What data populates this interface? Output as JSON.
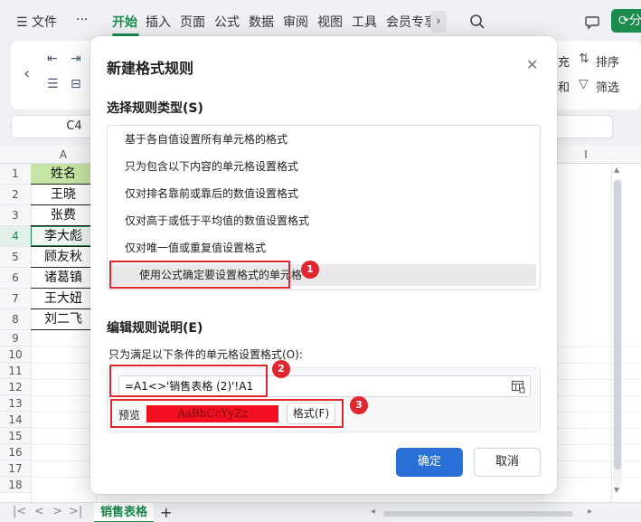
{
  "menubar": {
    "file": "文件",
    "more": "···",
    "tabs": [
      "开始",
      "插入",
      "页面",
      "公式",
      "数据",
      "审阅",
      "视图",
      "工具",
      "会员专享"
    ],
    "share": "分"
  },
  "ribbon": {
    "fill": "充",
    "sort": "排序",
    "sum": "和",
    "filter": "筛选"
  },
  "namebox": "C4",
  "sheet": {
    "columns": [
      "A",
      "I"
    ],
    "rows": [
      "1",
      "2",
      "3",
      "4",
      "5",
      "6",
      "7",
      "8",
      "9",
      "10",
      "11",
      "12",
      "13",
      "14",
      "15",
      "16",
      "17",
      "18"
    ],
    "cells": [
      "姓名",
      "王晓",
      "张费",
      "李大彪",
      "顾友秋",
      "诸葛镇",
      "王大妞",
      "刘二飞"
    ],
    "active_row": "4",
    "header_color": "#c6e4a4"
  },
  "sheet_tabs": {
    "active": "销售表格",
    "add": "+"
  },
  "dialog": {
    "title": "新建格式规则",
    "rule_type_label": "选择规则类型(S)",
    "rules": [
      "基于各自值设置所有单元格的格式",
      "只为包含以下内容的单元格设置格式",
      "仅对排名靠前或靠后的数值设置格式",
      "仅对高于或低于平均值的数值设置格式",
      "仅对唯一值或重复值设置格式",
      "使用公式确定要设置格式的单元格"
    ],
    "selected_rule_index": 5,
    "edit_label": "编辑规则说明(E)",
    "condition_label": "只为满足以下条件的单元格设置格式(O):",
    "formula": "=A1<>'销售表格 (2)'!A1",
    "preview_label": "预览",
    "preview_sample": "AaBbCcYyZz",
    "preview_fill": "#f20f1f",
    "format_button": "格式(F)",
    "ok": "确定",
    "cancel": "取消",
    "ok_color": "#2a6fd6"
  },
  "annotations": [
    "1",
    "2",
    "3"
  ],
  "annotation_color": "#e0262e"
}
